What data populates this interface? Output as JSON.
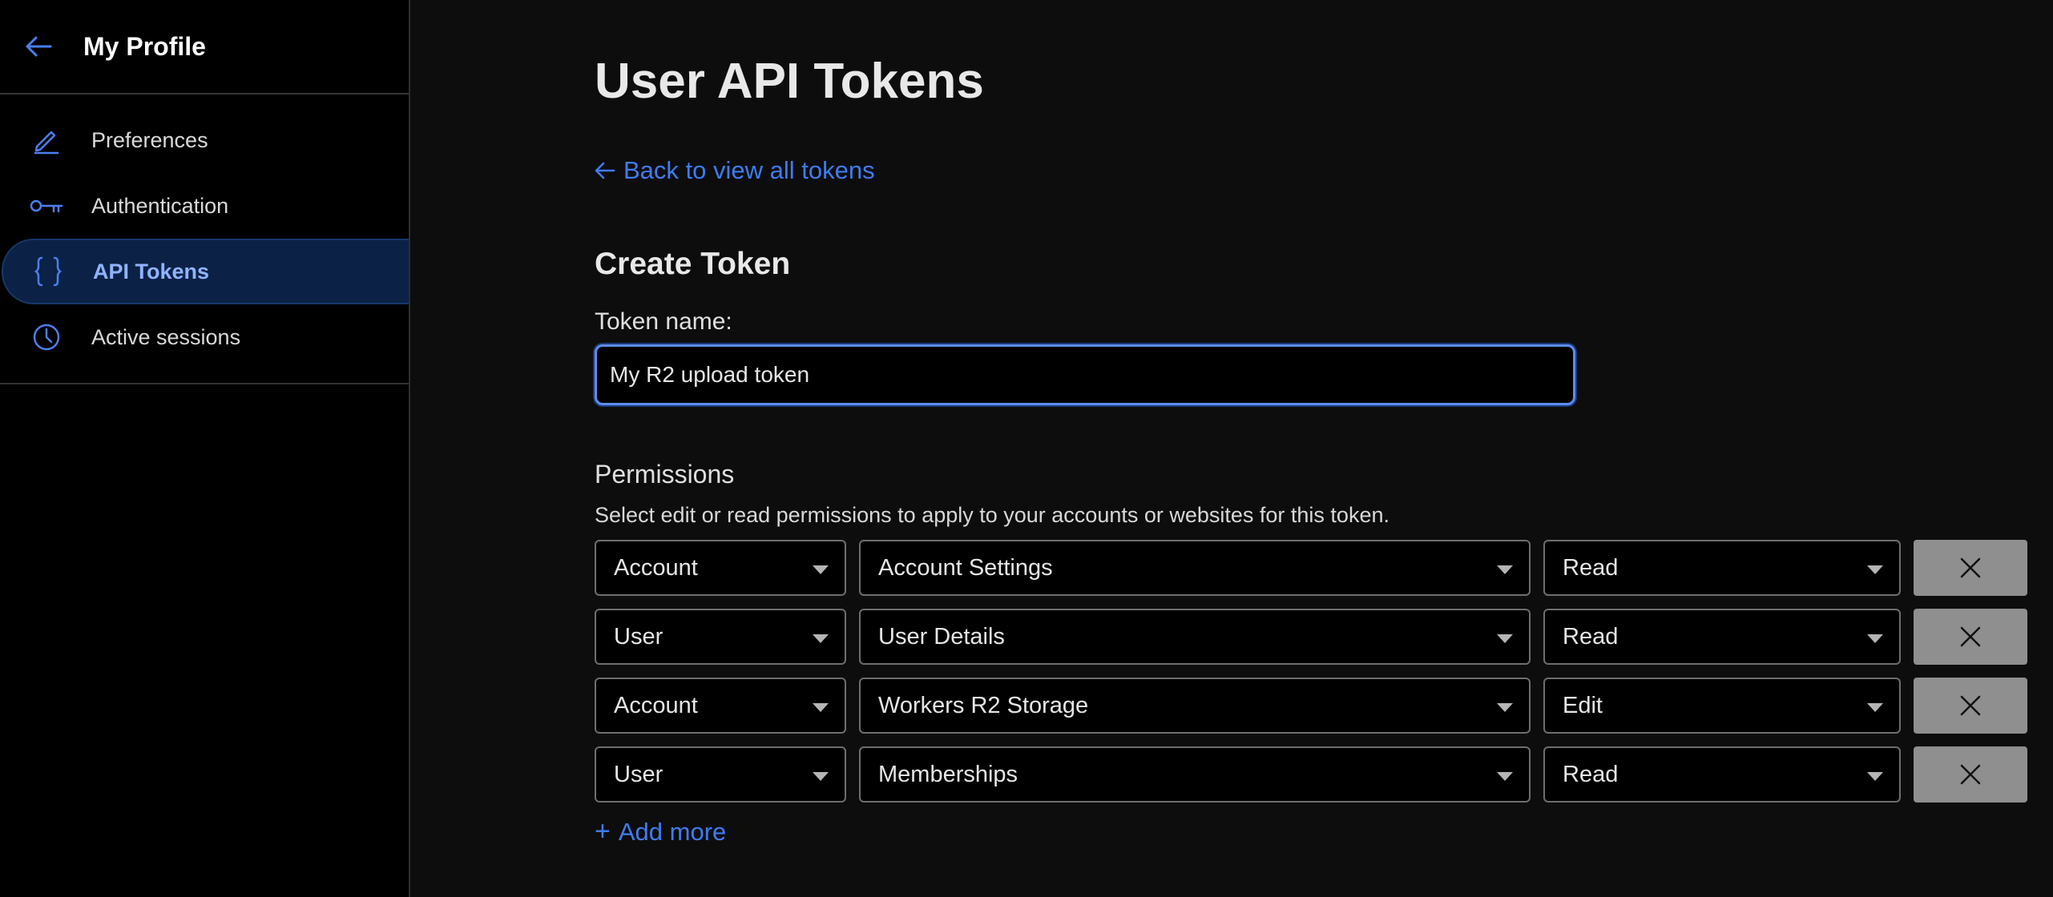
{
  "sidebar": {
    "title": "My Profile",
    "items": [
      {
        "label": "Preferences",
        "icon": "pencil-icon"
      },
      {
        "label": "Authentication",
        "icon": "key-icon"
      },
      {
        "label": "API Tokens",
        "icon": "braces-icon",
        "active": true
      },
      {
        "label": "Active sessions",
        "icon": "clock-icon"
      }
    ]
  },
  "main": {
    "title": "User API Tokens",
    "back_link": "Back to view all tokens",
    "section_title": "Create Token",
    "token_name_label": "Token name:",
    "token_name_value": "My R2 upload token",
    "permissions_title": "Permissions",
    "permissions_desc": "Select edit or read permissions to apply to your accounts or websites for this token.",
    "permissions": [
      {
        "scope": "Account",
        "resource": "Account Settings",
        "access": "Read"
      },
      {
        "scope": "User",
        "resource": "User Details",
        "access": "Read"
      },
      {
        "scope": "Account",
        "resource": "Workers R2 Storage",
        "access": "Edit"
      },
      {
        "scope": "User",
        "resource": "Memberships",
        "access": "Read"
      }
    ],
    "add_more": "Add more"
  },
  "colors": {
    "accent": "#3f7cf2",
    "sidebar_active_bg": "#0b2146",
    "remove_button": "#8f8f8f"
  }
}
